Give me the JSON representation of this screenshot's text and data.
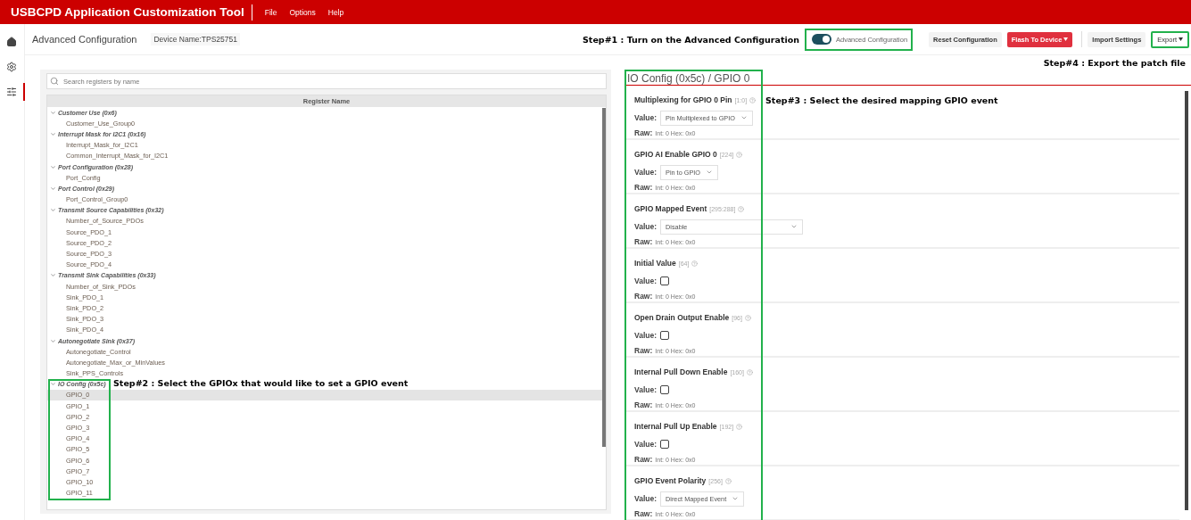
{
  "app_bar": {
    "title": "USBCPD Application Customization Tool",
    "menus": [
      "File",
      "Options",
      "Help"
    ]
  },
  "sidebar": {
    "items": [
      {
        "kind": "home",
        "selected": false
      },
      {
        "kind": "settings",
        "selected": false
      },
      {
        "kind": "sliders",
        "selected": true
      }
    ]
  },
  "toolbar": {
    "page_title": "Advanced Configuration",
    "device_name": "Device Name:TPS25751",
    "annotation": "Step#1 : Turn on the Advanced Configuration",
    "toggle": {
      "label": "Advanced Configuration",
      "on": true,
      "highlighted": true
    },
    "buttons": [
      {
        "label": "Reset Configuration",
        "kind": "plain",
        "dropdown": false,
        "highlighted": false
      },
      {
        "label": "Flash To Device",
        "kind": "primary",
        "dropdown": true,
        "highlighted": false
      },
      {
        "label": "Import Settings",
        "kind": "plain",
        "dropdown": false,
        "highlighted": false
      },
      {
        "label": "Export",
        "kind": "outline",
        "dropdown": true,
        "highlighted": true
      }
    ],
    "export_annotation": "Step#4 : Export the patch file"
  },
  "register_tree": {
    "search": {
      "placeholder": "Search registers by name"
    },
    "column": "Register Name",
    "groups": [
      {
        "label": "Customer Use (0x6)",
        "expanded": true,
        "children": [
          {
            "label": "Customer_Use_Group0",
            "selected": false
          }
        ]
      },
      {
        "label": "Interrupt Mask for I2C1 (0x16)",
        "expanded": true,
        "children": [
          {
            "label": "Interrupt_Mask_for_I2C1",
            "selected": false
          },
          {
            "label": "Common_Interrupt_Mask_for_I2C1",
            "selected": false
          }
        ]
      },
      {
        "label": "Port Configuration (0x28)",
        "expanded": true,
        "children": [
          {
            "label": "Port_Config",
            "selected": false
          }
        ]
      },
      {
        "label": "Port Control (0x29)",
        "expanded": true,
        "children": [
          {
            "label": "Port_Control_Group0",
            "selected": false
          }
        ]
      },
      {
        "label": "Transmit Source Capabilities (0x32)",
        "expanded": true,
        "children": [
          {
            "label": "Number_of_Source_PDOs",
            "selected": false
          },
          {
            "label": "Source_PDO_1",
            "selected": false
          },
          {
            "label": "Source_PDO_2",
            "selected": false
          },
          {
            "label": "Source_PDO_3",
            "selected": false
          },
          {
            "label": "Source_PDO_4",
            "selected": false
          }
        ]
      },
      {
        "label": "Transmit Sink Capabilities (0x33)",
        "expanded": true,
        "children": [
          {
            "label": "Number_of_Sink_PDOs",
            "selected": false
          },
          {
            "label": "Sink_PDO_1",
            "selected": false
          },
          {
            "label": "Sink_PDO_2",
            "selected": false
          },
          {
            "label": "Sink_PDO_3",
            "selected": false
          },
          {
            "label": "Sink_PDO_4",
            "selected": false
          }
        ]
      },
      {
        "label": "Autonegotiate Sink (0x37)",
        "expanded": true,
        "children": [
          {
            "label": "Autonegotiate_Control",
            "selected": false
          },
          {
            "label": "Autonegotiate_Max_or_MinValues",
            "selected": false
          },
          {
            "label": "Sink_PPS_Controls",
            "selected": false
          }
        ]
      },
      {
        "label": "IO Config (0x5c)",
        "expanded": true,
        "highlighted": true,
        "annotation": "Step#2 : Select the GPIOx that would like to set a GPIO event",
        "children": [
          {
            "label": "GPIO_0",
            "selected": true
          },
          {
            "label": "GPIO_1",
            "selected": false
          },
          {
            "label": "GPIO_2",
            "selected": false
          },
          {
            "label": "GPIO_3",
            "selected": false
          },
          {
            "label": "GPIO_4",
            "selected": false
          },
          {
            "label": "GPIO_5",
            "selected": false
          },
          {
            "label": "GPIO_6",
            "selected": false
          },
          {
            "label": "GPIO_7",
            "selected": false
          },
          {
            "label": "GPIO_10",
            "selected": false
          },
          {
            "label": "GPIO_11",
            "selected": false
          }
        ]
      }
    ]
  },
  "detail": {
    "title": "IO Config (0x5c) / GPIO 0",
    "highlighted": true,
    "annotation": "Step#3 : Select the desired mapping GPIO event",
    "fields": [
      {
        "name": "Multiplexing for GPIO 0 Pin",
        "bits": "[1:0]",
        "kind": "select",
        "value_label": "Value:",
        "value": "Pin Multiplexed to GPIO",
        "raw_label": "Raw:",
        "raw": "Int: 0 Hex: 0x0"
      },
      {
        "name": "GPIO AI Enable GPIO 0",
        "bits": "[224]",
        "kind": "select",
        "value_label": "Value:",
        "value": "Pin to GPIO",
        "raw_label": "Raw:",
        "raw": "Int: 0 Hex: 0x0"
      },
      {
        "name": "GPIO Mapped Event",
        "bits": "[295:288]",
        "kind": "wide-select",
        "value_label": "Value:",
        "value": "Disable",
        "raw_label": "Raw:",
        "raw": "Int: 0 Hex: 0x0"
      },
      {
        "name": "Initial Value",
        "bits": "[64]",
        "kind": "checkbox",
        "value_label": "Value:",
        "checked": false,
        "raw_label": "Raw:",
        "raw": "Int: 0 Hex: 0x0"
      },
      {
        "name": "Open Drain Output Enable",
        "bits": "[96]",
        "kind": "checkbox",
        "value_label": "Value:",
        "checked": false,
        "raw_label": "Raw:",
        "raw": "Int: 0 Hex: 0x0"
      },
      {
        "name": "Internal Pull Down Enable",
        "bits": "[160]",
        "kind": "checkbox",
        "value_label": "Value:",
        "checked": false,
        "raw_label": "Raw:",
        "raw": "Int: 0 Hex: 0x0"
      },
      {
        "name": "Internal Pull Up Enable",
        "bits": "[192]",
        "kind": "checkbox",
        "value_label": "Value:",
        "checked": false,
        "raw_label": "Raw:",
        "raw": "Int: 0 Hex: 0x0"
      },
      {
        "name": "GPIO Event Polarity",
        "bits": "[256]",
        "kind": "select",
        "value_label": "Value:",
        "value": "Direct Mapped Event",
        "raw_label": "Raw:",
        "raw": "Int: 0 Hex: 0x0"
      }
    ]
  }
}
